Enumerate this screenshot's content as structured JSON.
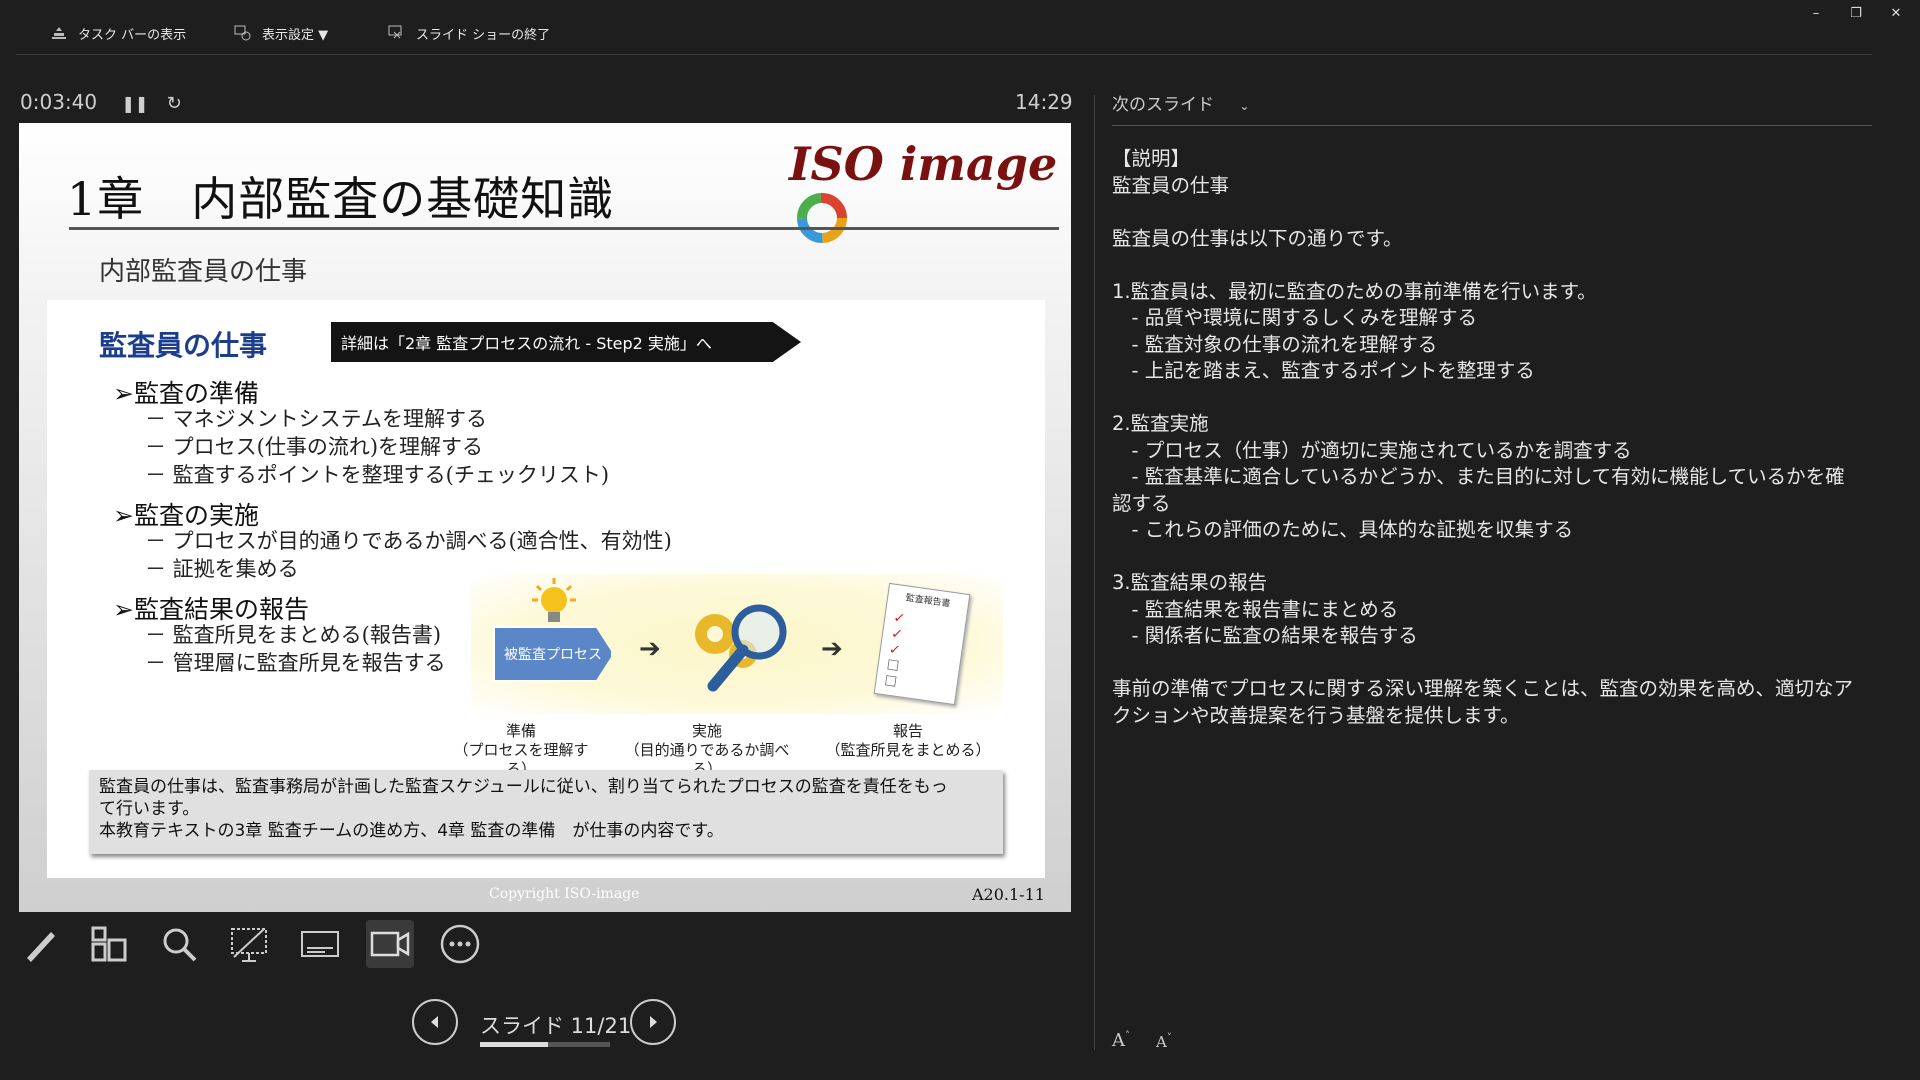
{
  "toolbar": {
    "taskbar_label": "タスク バーの表示",
    "display_settings_label": "表示設定 ▼",
    "end_show_label": "スライド ショーの終了"
  },
  "presenter": {
    "elapsed": "0:03:40",
    "clock": "14:29",
    "slide_counter": "スライド 11/21",
    "progress": 0.524
  },
  "slide": {
    "title": "1章　内部監査の基礎知識",
    "subtitle": "内部監査員の仕事",
    "logo_text": "ISO image",
    "section_title": "監査員の仕事",
    "banner": "詳細は「2章 監査プロセスの流れ - Step2 実施」へ",
    "bullets": [
      {
        "head": "➢監査の準備",
        "subs": [
          "－ マネジメントシステムを理解する",
          "－ プロセス(仕事の流れ)を理解する",
          "－ 監査するポイントを整理する(チェックリスト)"
        ]
      },
      {
        "head": "➢監査の実施",
        "subs": [
          "－ プロセスが目的通りであるか調べる(適合性、有効性)",
          "－ 証拠を集める"
        ]
      },
      {
        "head": "➢監査結果の報告",
        "subs": [
          "－ 監査所見をまとめる(報告書)",
          "－ 管理層に監査所見を報告する"
        ]
      }
    ],
    "diagram": {
      "process_label": "被監査プロセス",
      "report_doc_title": "監査報告書",
      "captions": [
        {
          "title": "準備",
          "detail": "（プロセスを理解する）"
        },
        {
          "title": "実施",
          "detail": "（目的通りであるか調べる）"
        },
        {
          "title": "報告",
          "detail": "（監査所見をまとめる）"
        }
      ]
    },
    "note_lines": [
      "監査員の仕事は、監査事務局が計画した監査スケジュールに従い、割り当てられたプロセスの監査を責任をもっ",
      "て行います。",
      "本教育テキストの3章 監査チームの進め方、4章 監査の準備　が仕事の内容です。"
    ],
    "copyright": "Copyright  ISO-image",
    "page_number": "A20.1-11"
  },
  "tools": [
    "pen-icon",
    "slides-grid-icon",
    "zoom-icon",
    "pointer-screen-icon",
    "subtitles-icon",
    "camera-icon",
    "more-icon"
  ],
  "notes_panel": {
    "next_slide_label": "次のスライド",
    "text": "【説明】\n監査員の仕事\n\n監査員の仕事は以下の通りです。\n\n1.監査員は、最初に監査のための事前準備を行います。\n　- 品質や環境に関するしくみを理解する\n　- 監査対象の仕事の流れを理解する\n　- 上記を踏まえ、監査するポイントを整理する\n\n2.監査実施\n　- プロセス（仕事）が適切に実施されているかを調査する\n　- 監査基準に適合しているかどうか、また目的に対して有効に機能しているかを確認する\n　- これらの評価のために、具体的な証拠を収集する\n\n3.監査結果の報告\n　- 監査結果を報告書にまとめる\n　- 関係者に監査の結果を報告する\n\n事前の準備でプロセスに関する深い理解を築くことは、監査の効果を高め、適切なアクションや改善提案を行う基盤を提供します。",
    "font_up": "A",
    "font_down": "A"
  }
}
